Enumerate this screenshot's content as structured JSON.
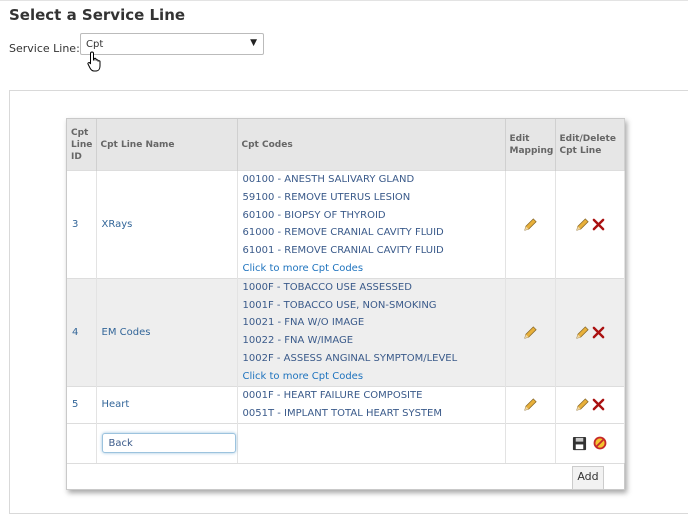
{
  "page": {
    "title": "Select a Service Line"
  },
  "service_line": {
    "label": "Service Line:",
    "selected": "Cpt"
  },
  "grid": {
    "headers": {
      "id": "Cpt Line ID",
      "name": "Cpt Line Name",
      "codes": "Cpt Codes",
      "edit_mapping": "Edit Mapping",
      "edit_delete": "Edit/Delete Cpt Line"
    },
    "rows": [
      {
        "id": "3",
        "name": "XRays",
        "codes": [
          "00100 - ANESTH SALIVARY GLAND",
          "59100 - REMOVE UTERUS LESION",
          "60100 - BIOPSY OF THYROID",
          "61000 - REMOVE CRANIAL CAVITY FLUID",
          "61001 - REMOVE CRANIAL CAVITY FLUID"
        ],
        "more": "Click to more Cpt Codes"
      },
      {
        "id": "4",
        "name": "EM Codes",
        "codes": [
          "1000F - TOBACCO USE ASSESSED",
          "1001F - TOBACCO USE, NON-SMOKING",
          "10021 - FNA W/O IMAGE",
          "10022 - FNA W/IMAGE",
          "1002F - ASSESS ANGINAL SYMPTOM/LEVEL"
        ],
        "more": "Click to more Cpt Codes"
      },
      {
        "id": "5",
        "name": "Heart",
        "codes": [
          "0001F - HEART FAILURE COMPOSITE",
          "0051T - IMPLANT TOTAL HEART SYSTEM"
        ],
        "more": ""
      }
    ],
    "edit_row": {
      "value": "Back"
    },
    "add_label": "Add"
  },
  "colors": {
    "link": "#1e73be",
    "text": "#3a5a8a",
    "delete": "#aa1111",
    "pencil": "#e0a020"
  }
}
